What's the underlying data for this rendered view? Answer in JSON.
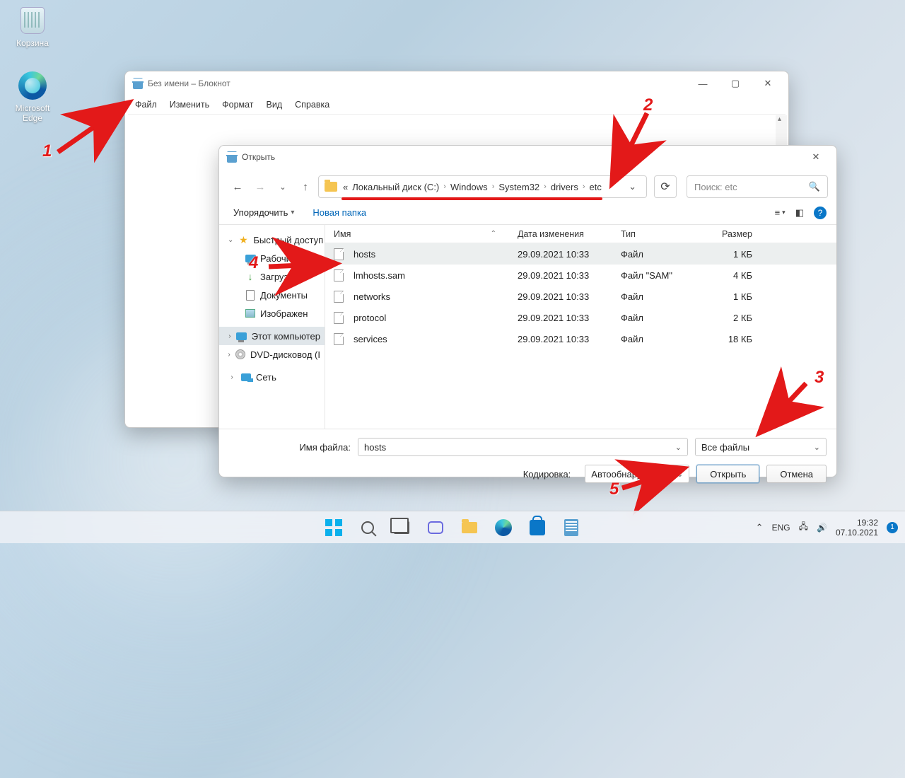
{
  "desktop": {
    "recycle_bin": "Корзина",
    "edge": "Microsoft Edge"
  },
  "notepad": {
    "title": "Без имени – Блокнот",
    "menu": {
      "file": "Файл",
      "edit": "Изменить",
      "format": "Формат",
      "view": "Вид",
      "help": "Справка"
    }
  },
  "open_dialog": {
    "title": "Открыть",
    "breadcrumb": {
      "prefix": "«",
      "c0": "Локальный диск (C:)",
      "c1": "Windows",
      "c2": "System32",
      "c3": "drivers",
      "c4": "etc"
    },
    "search_placeholder": "Поиск: etc",
    "toolbar": {
      "organize": "Упорядочить",
      "new_folder": "Новая папка"
    },
    "tree": {
      "quick_access": "Быстрый доступ",
      "desktop": "Рабочий сто",
      "downloads": "Загрузки",
      "documents": "Документы",
      "pictures": "Изображен",
      "this_pc": "Этот компьютер",
      "dvd": "DVD-дисковод (I",
      "network": "Сеть"
    },
    "columns": {
      "name": "Имя",
      "date": "Дата изменения",
      "type": "Тип",
      "size": "Размер"
    },
    "files": [
      {
        "name": "hosts",
        "date": "29.09.2021 10:33",
        "type": "Файл",
        "size": "1 КБ"
      },
      {
        "name": "lmhosts.sam",
        "date": "29.09.2021 10:33",
        "type": "Файл \"SAM\"",
        "size": "4 КБ"
      },
      {
        "name": "networks",
        "date": "29.09.2021 10:33",
        "type": "Файл",
        "size": "1 КБ"
      },
      {
        "name": "protocol",
        "date": "29.09.2021 10:33",
        "type": "Файл",
        "size": "2 КБ"
      },
      {
        "name": "services",
        "date": "29.09.2021 10:33",
        "type": "Файл",
        "size": "18 КБ"
      }
    ],
    "filename_label": "Имя файла:",
    "filename_value": "hosts",
    "filter_value": "Все файлы",
    "encoding_label": "Кодировка:",
    "encoding_value": "Автообнаружение",
    "open_btn": "Открыть",
    "cancel_btn": "Отмена"
  },
  "annotations": {
    "n1": "1",
    "n2": "2",
    "n3": "3",
    "n4": "4",
    "n5": "5"
  },
  "taskbar": {
    "lang": "ENG",
    "time": "19:32",
    "date": "07.10.2021",
    "notif_count": "1"
  }
}
